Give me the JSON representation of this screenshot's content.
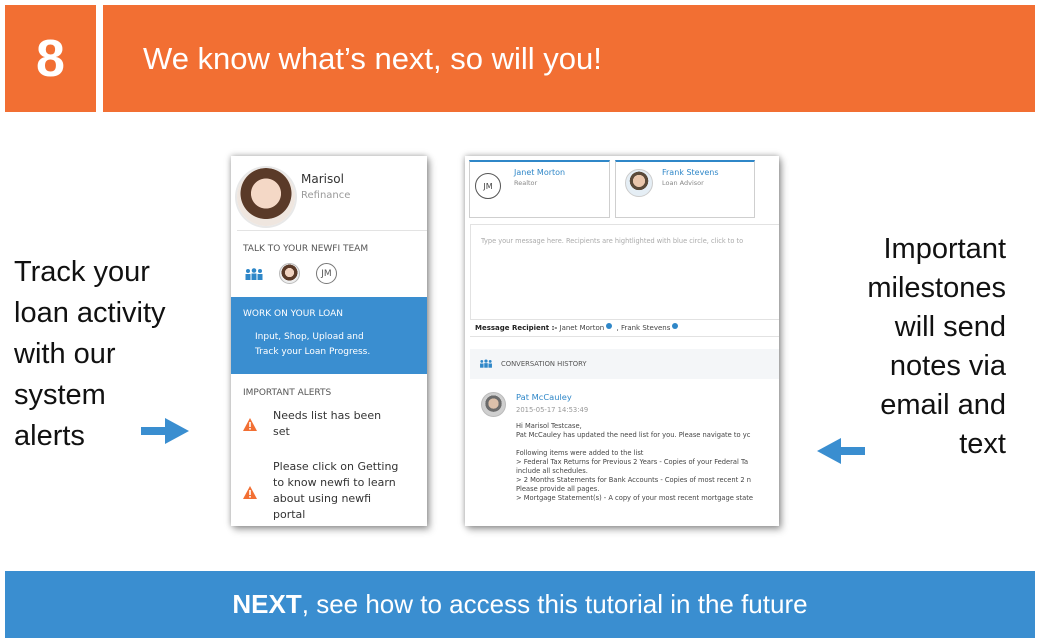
{
  "header": {
    "step_number": "8",
    "title": "We know what’s next, so will you!",
    "accent_color": "#f26f33"
  },
  "left_caption": {
    "lines": [
      "Track your",
      "loan activity",
      "with our",
      "system",
      "alerts"
    ]
  },
  "right_caption": {
    "lines": [
      "Important",
      "milestones",
      "will send",
      "notes via",
      "email and",
      "text"
    ]
  },
  "arrows": {
    "left_arrow_icon": "arrow-right-icon",
    "right_arrow_icon": "arrow-left-icon",
    "color": "#3a8ed0"
  },
  "sidebar_panel": {
    "user_name": "Marisol",
    "user_subtitle": "Refinance",
    "team_heading": "TALK TO YOUR NEWFI TEAM",
    "team_icon": "people-icon",
    "team_member_initials": "JM",
    "work_heading": "WORK ON YOUR LOAN",
    "work_line1": "Input, Shop, Upload and",
    "work_line2": "Track your Loan Progress.",
    "alerts_heading": "IMPORTANT ALERTS",
    "alerts": [
      {
        "icon": "warning-icon",
        "lines": [
          "Needs list has been",
          "set"
        ]
      },
      {
        "icon": "warning-icon",
        "lines": [
          "Please click on Getting",
          "to know newfi to learn",
          "about using newfi",
          "portal"
        ]
      }
    ]
  },
  "conversation_panel": {
    "contacts": [
      {
        "initials": "JM",
        "name": "Janet Morton",
        "role": "Realtor"
      },
      {
        "name": "Frank Stevens",
        "role": "Loan Advisor"
      }
    ],
    "message_placeholder": "Type your message here. Recipients are hightlighted with blue circle, click to to",
    "recipient_label": "Message Recipient :-",
    "recipients": [
      "Janet Morton",
      "Frank Stevens"
    ],
    "history_heading": "CONVERSATION HISTORY",
    "history_icon": "people-icon",
    "message": {
      "author": "Pat McCauley",
      "timestamp": "2015-05-17 14:53:49",
      "body_lines": [
        "Hi Marisol Testcase,",
        "Pat McCauley has updated the need list for you. Please navigate to yc",
        "",
        "Following items were added to the list",
        "> Federal Tax Returns for Previous 2 Years - Copies of your Federal Ta",
        "include all schedules.",
        "> 2 Months Statements for Bank Accounts - Copies of most recent 2 n",
        "Please provide all pages.",
        "> Mortgage Statement(s) - A copy of your most recent mortgage state"
      ]
    }
  },
  "footer": {
    "bold": "NEXT",
    "rest": ", see how to access this tutorial in the future",
    "color": "#3a8ed0"
  }
}
